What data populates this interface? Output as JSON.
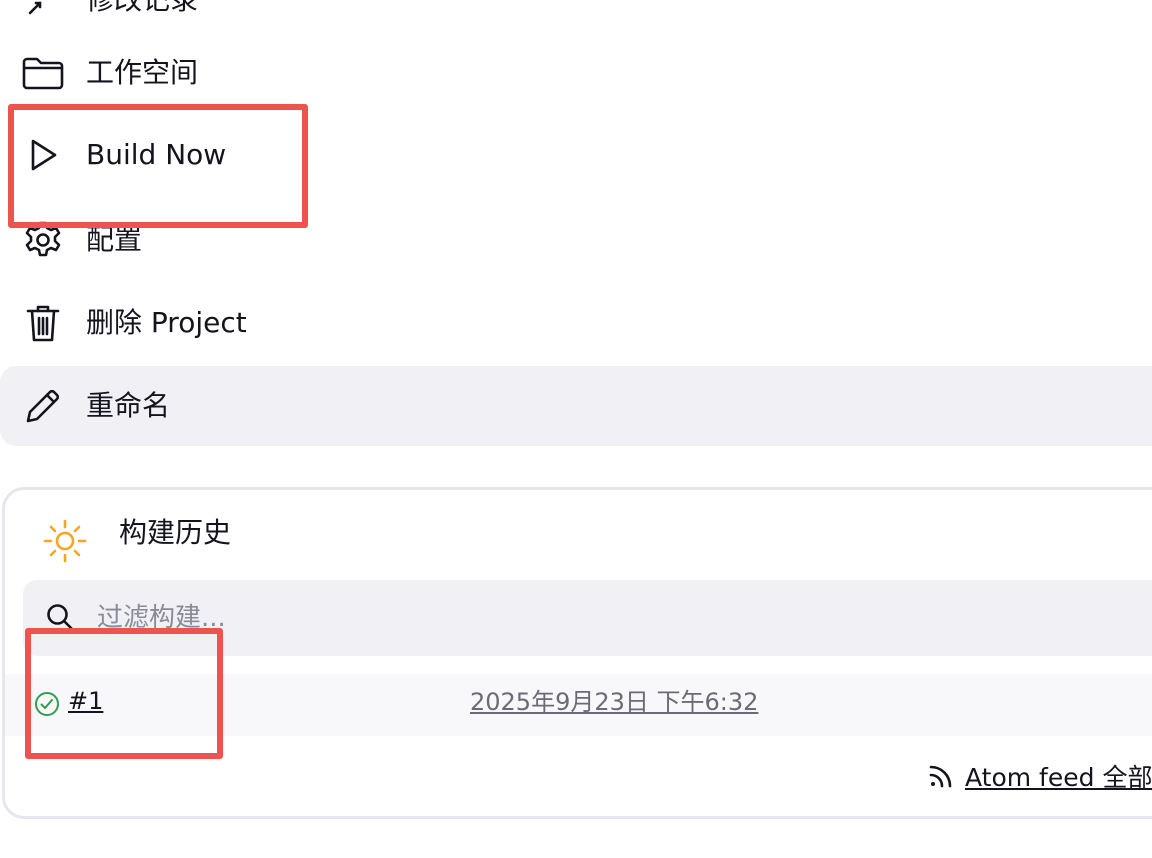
{
  "menu": {
    "items": [
      {
        "id": "changes",
        "label": "修改记录",
        "icon": "changes-icon"
      },
      {
        "id": "workspace",
        "label": "工作空间",
        "icon": "folder-icon"
      },
      {
        "id": "build-now",
        "label": "Build Now",
        "icon": "play-icon"
      },
      {
        "id": "configure",
        "label": "配置",
        "icon": "gear-icon"
      },
      {
        "id": "delete",
        "label": "删除 Project",
        "icon": "trash-icon"
      },
      {
        "id": "rename",
        "label": "重命名",
        "icon": "pencil-icon"
      }
    ]
  },
  "build_history": {
    "title": "构建历史",
    "title_icon": "sun-icon",
    "search_placeholder": "过滤构建...",
    "builds": [
      {
        "number": "#1",
        "time": "2025年9月23日 下午6:32",
        "status": "success"
      }
    ],
    "atom_feed_label": "Atom feed 全部"
  },
  "colors": {
    "accent_red": "#ef5350",
    "success_green": "#2e9e4f",
    "sun_orange": "#f5a623",
    "highlight_bg": "#f1f1f5"
  }
}
